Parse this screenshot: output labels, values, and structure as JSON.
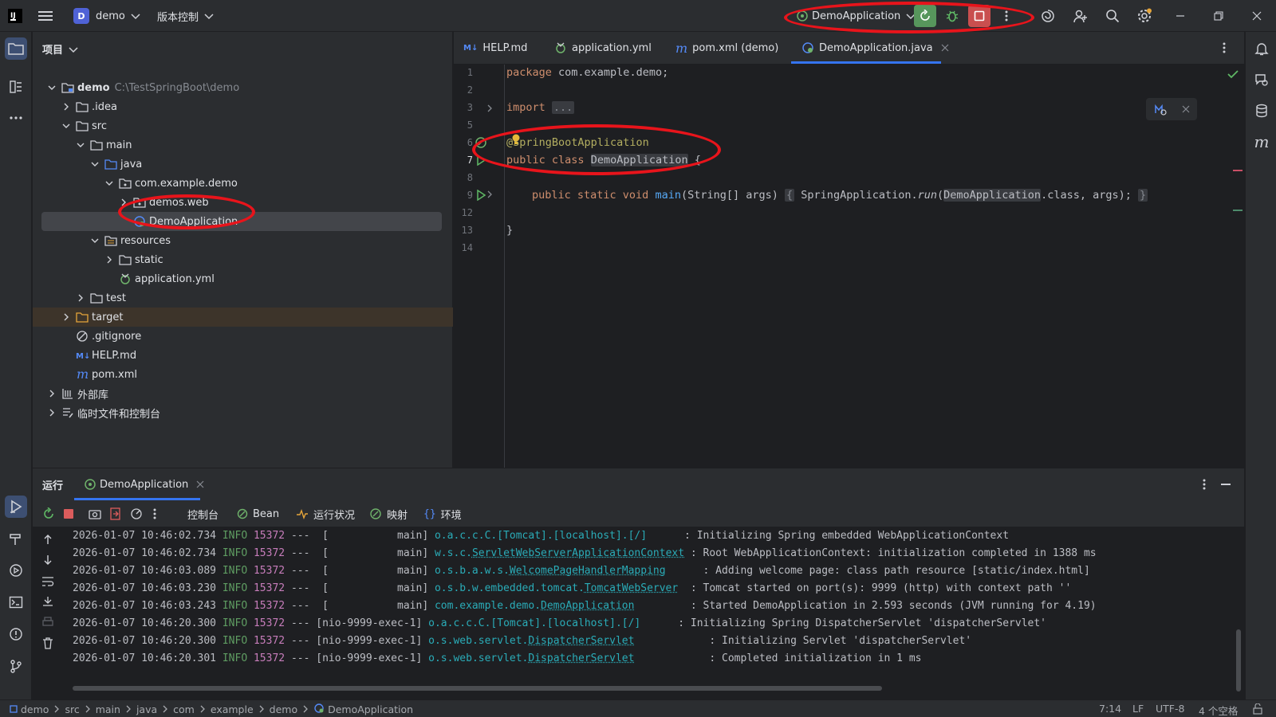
{
  "titlebar": {
    "project_badge": "D",
    "project_name": "demo",
    "vcs_label": "版本控制",
    "run_config": "DemoApplication",
    "icons": [
      "app-icon",
      "hamburger-icon",
      "rerun-icon",
      "debug-icon",
      "stop-icon",
      "more-icon",
      "ai-icon",
      "add-user-icon",
      "search-icon",
      "settings-icon",
      "minimize-icon",
      "restore-icon",
      "close-icon"
    ]
  },
  "project_panel": {
    "title": "项目",
    "tree": [
      {
        "label": "demo",
        "path": "C:\\TestSpringBoot\\demo",
        "icon": "module-folder-icon"
      },
      {
        "label": ".idea",
        "icon": "folder-icon"
      },
      {
        "label": "src",
        "icon": "folder-icon"
      },
      {
        "label": "main",
        "icon": "folder-icon"
      },
      {
        "label": "java",
        "icon": "source-folder-icon"
      },
      {
        "label": "com.example.demo",
        "icon": "package-icon"
      },
      {
        "label": "demos.web",
        "icon": "package-icon"
      },
      {
        "label": "DemoApplication",
        "icon": "spring-class-icon"
      },
      {
        "label": "resources",
        "icon": "resources-folder-icon"
      },
      {
        "label": "static",
        "icon": "folder-icon"
      },
      {
        "label": "application.yml",
        "icon": "yaml-icon"
      },
      {
        "label": "test",
        "icon": "folder-icon"
      },
      {
        "label": "target",
        "icon": "excluded-folder-icon"
      },
      {
        "label": ".gitignore",
        "icon": "gitignore-icon"
      },
      {
        "label": "HELP.md",
        "icon": "markdown-icon"
      },
      {
        "label": "pom.xml",
        "icon": "maven-icon"
      },
      {
        "label": "外部库",
        "icon": "library-icon"
      },
      {
        "label": "临时文件和控制台",
        "icon": "scratch-icon"
      }
    ]
  },
  "editor": {
    "tabs": [
      {
        "label": "HELP.md",
        "icon": "markdown-icon"
      },
      {
        "label": "application.yml",
        "icon": "yaml-icon"
      },
      {
        "label": "pom.xml (demo)",
        "icon": "maven-icon"
      },
      {
        "label": "DemoApplication.java",
        "icon": "spring-class-icon",
        "active": true
      }
    ],
    "line_numbers": [
      "1",
      "2",
      "3",
      "5",
      "6",
      "7",
      "8",
      "9",
      "12",
      "13",
      "14"
    ],
    "code": {
      "l1_kw": "package",
      "l1_rest": " com.example.demo;",
      "l3_kw": "import",
      "l3_fold": "...",
      "l6_ann": "@SpringBootApplication",
      "l7_kw": "public class",
      "l7_name": "DemoApplication",
      "l7_brace": " {",
      "l9_kw": "public static void",
      "l9_fn": "main",
      "l9_args": "(String[] args)",
      "l9_open": "{",
      "l9_body1": " SpringApplication.",
      "l9_run": "run",
      "l9_paren": "(",
      "l9_cls": "DemoApplication",
      "l9_rest": ".class, args);",
      "l9_close": "}",
      "l13": "}"
    }
  },
  "run_panel": {
    "title": "运行",
    "tab_label": "DemoApplication",
    "toolbar": [
      "控制台",
      "Bean",
      "运行状况",
      "映射",
      "环境"
    ],
    "logs": [
      {
        "ts": "2026-01-07 10:46:02.734",
        "level": "INFO",
        "pid": "15372",
        "thread": "---  [           main]",
        "logger_pre": "o.a.c.c.C.[Tomcat].[localhost].[/]",
        "logger_link": "",
        "msg": "      : Initializing Spring embedded WebApplicationContext"
      },
      {
        "ts": "2026-01-07 10:46:02.734",
        "level": "INFO",
        "pid": "15372",
        "thread": "---  [           main]",
        "logger_pre": "w.s.c.",
        "logger_link": "ServletWebServerApplicationContext",
        "msg": " : Root WebApplicationContext: initialization completed in 1388 ms"
      },
      {
        "ts": "2026-01-07 10:46:03.089",
        "level": "INFO",
        "pid": "15372",
        "thread": "---  [           main]",
        "logger_pre": "o.s.b.a.w.s.",
        "logger_link": "WelcomePageHandlerMapping",
        "msg": "      : Adding welcome page: class path resource [static/index.html]"
      },
      {
        "ts": "2026-01-07 10:46:03.230",
        "level": "INFO",
        "pid": "15372",
        "thread": "---  [           main]",
        "logger_pre": "o.s.b.w.embedded.tomcat.",
        "logger_link": "TomcatWebServer",
        "msg": "  : Tomcat started on port(s): 9999 (http) with context path ''"
      },
      {
        "ts": "2026-01-07 10:46:03.243",
        "level": "INFO",
        "pid": "15372",
        "thread": "---  [           main]",
        "logger_pre": "com.example.demo.",
        "logger_link": "DemoApplication",
        "msg": "         : Started DemoApplication in 2.593 seconds (JVM running for 4.19)"
      },
      {
        "ts": "2026-01-07 10:46:20.300",
        "level": "INFO",
        "pid": "15372",
        "thread": "--- [nio-9999-exec-1]",
        "logger_pre": "o.a.c.c.C.[Tomcat].[localhost].[/]",
        "logger_link": "",
        "msg": "      : Initializing Spring DispatcherServlet 'dispatcherServlet'"
      },
      {
        "ts": "2026-01-07 10:46:20.300",
        "level": "INFO",
        "pid": "15372",
        "thread": "--- [nio-9999-exec-1]",
        "logger_pre": "o.s.web.servlet.",
        "logger_link": "DispatcherServlet",
        "msg": "            : Initializing Servlet 'dispatcherServlet'"
      },
      {
        "ts": "2026-01-07 10:46:20.301",
        "level": "INFO",
        "pid": "15372",
        "thread": "--- [nio-9999-exec-1]",
        "logger_pre": "o.s.web.servlet.",
        "logger_link": "DispatcherServlet",
        "msg": "            : Completed initialization in 1 ms"
      }
    ]
  },
  "statusbar": {
    "breadcrumbs": [
      "demo",
      "src",
      "main",
      "java",
      "com",
      "example",
      "demo",
      "DemoApplication"
    ],
    "position": "7:14",
    "line_sep": "LF",
    "encoding": "UTF-8",
    "indent": "4 个空格"
  }
}
